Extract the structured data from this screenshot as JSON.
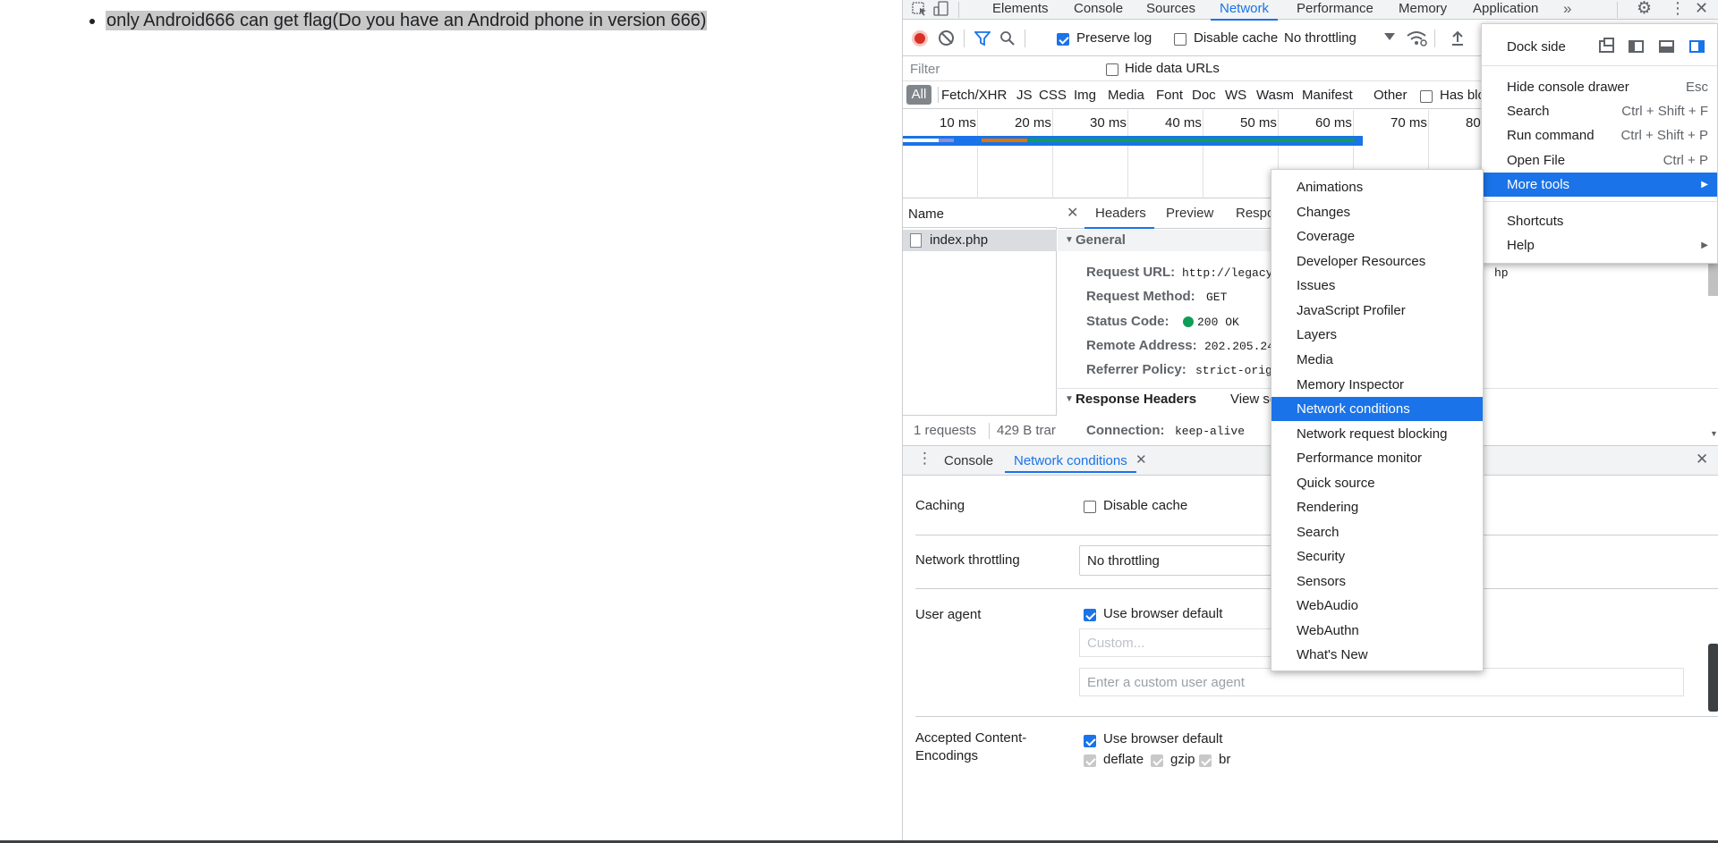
{
  "page": {
    "bullet_text": "only Android666 can get flag(Do you have an Android phone in version 666)"
  },
  "tabs": [
    "Elements",
    "Console",
    "Sources",
    "Network",
    "Performance",
    "Memory",
    "Application"
  ],
  "toolbar": {
    "preserve_log": "Preserve log",
    "disable_cache": "Disable cache",
    "throttling": "No throttling"
  },
  "filter": {
    "placeholder": "Filter",
    "hide_data_urls": "Hide data URLs"
  },
  "types": [
    "All",
    "Fetch/XHR",
    "JS",
    "CSS",
    "Img",
    "Media",
    "Font",
    "Doc",
    "WS",
    "Wasm",
    "Manifest",
    "Other"
  ],
  "has_blocked": "Has blo",
  "timeline_ticks": [
    "10 ms",
    "20 ms",
    "30 ms",
    "40 ms",
    "50 ms",
    "60 ms",
    "70 ms",
    "80"
  ],
  "requests": {
    "name_header": "Name",
    "rows": [
      "index.php"
    ],
    "summary": "1 requests",
    "transfer": "429 B trar"
  },
  "detail_tabs": [
    "Headers",
    "Preview",
    "Respo"
  ],
  "general": {
    "title": "General",
    "rows": [
      {
        "label": "Request URL:",
        "value": "http://legacy"
      },
      {
        "label": "Request Method:",
        "value": "GET"
      },
      {
        "label": "Status Code:",
        "value": "200 OK"
      },
      {
        "label": "Remote Address:",
        "value": "202.205.24"
      },
      {
        "label": "Referrer Policy:",
        "value": "strict-orig"
      }
    ],
    "url_tail": "hp"
  },
  "response_headers": {
    "title": "Response Headers",
    "view_source": "View so",
    "connection_label": "Connection:",
    "connection_value": "keep-alive"
  },
  "drawer": {
    "tabs": [
      "Console",
      "Network conditions"
    ],
    "caching": {
      "label": "Caching",
      "option": "Disable cache"
    },
    "throttling": {
      "label": "Network throttling",
      "value": "No throttling"
    },
    "user_agent": {
      "label": "User agent",
      "option": "Use browser default",
      "custom_placeholder": "Custom...",
      "custom_input_placeholder": "Enter a custom user agent"
    },
    "encodings": {
      "label_line1": "Accepted Content-",
      "label_line2": "Encodings",
      "option": "Use browser default",
      "items": [
        "deflate",
        "gzip",
        "br"
      ]
    }
  },
  "main_menu": {
    "dock_side": "Dock side",
    "items": [
      {
        "label": "Hide console drawer",
        "shortcut": "Esc"
      },
      {
        "label": "Search",
        "shortcut": "Ctrl + Shift + F"
      },
      {
        "label": "Run command",
        "shortcut": "Ctrl + Shift + P"
      },
      {
        "label": "Open File",
        "shortcut": "Ctrl + P"
      },
      {
        "label": "More tools",
        "shortcut": ""
      },
      {
        "label": "Shortcuts",
        "shortcut": ""
      },
      {
        "label": "Help",
        "shortcut": ""
      }
    ]
  },
  "more_tools": [
    "Animations",
    "Changes",
    "Coverage",
    "Developer Resources",
    "Issues",
    "JavaScript Profiler",
    "Layers",
    "Media",
    "Memory Inspector",
    "Network conditions",
    "Network request blocking",
    "Performance monitor",
    "Quick source",
    "Rendering",
    "Search",
    "Security",
    "Sensors",
    "WebAudio",
    "WebAuthn",
    "What's New"
  ],
  "colors": {
    "accent": "#1a73e8",
    "record": "#d93025",
    "status_ok": "#0f9d58"
  }
}
